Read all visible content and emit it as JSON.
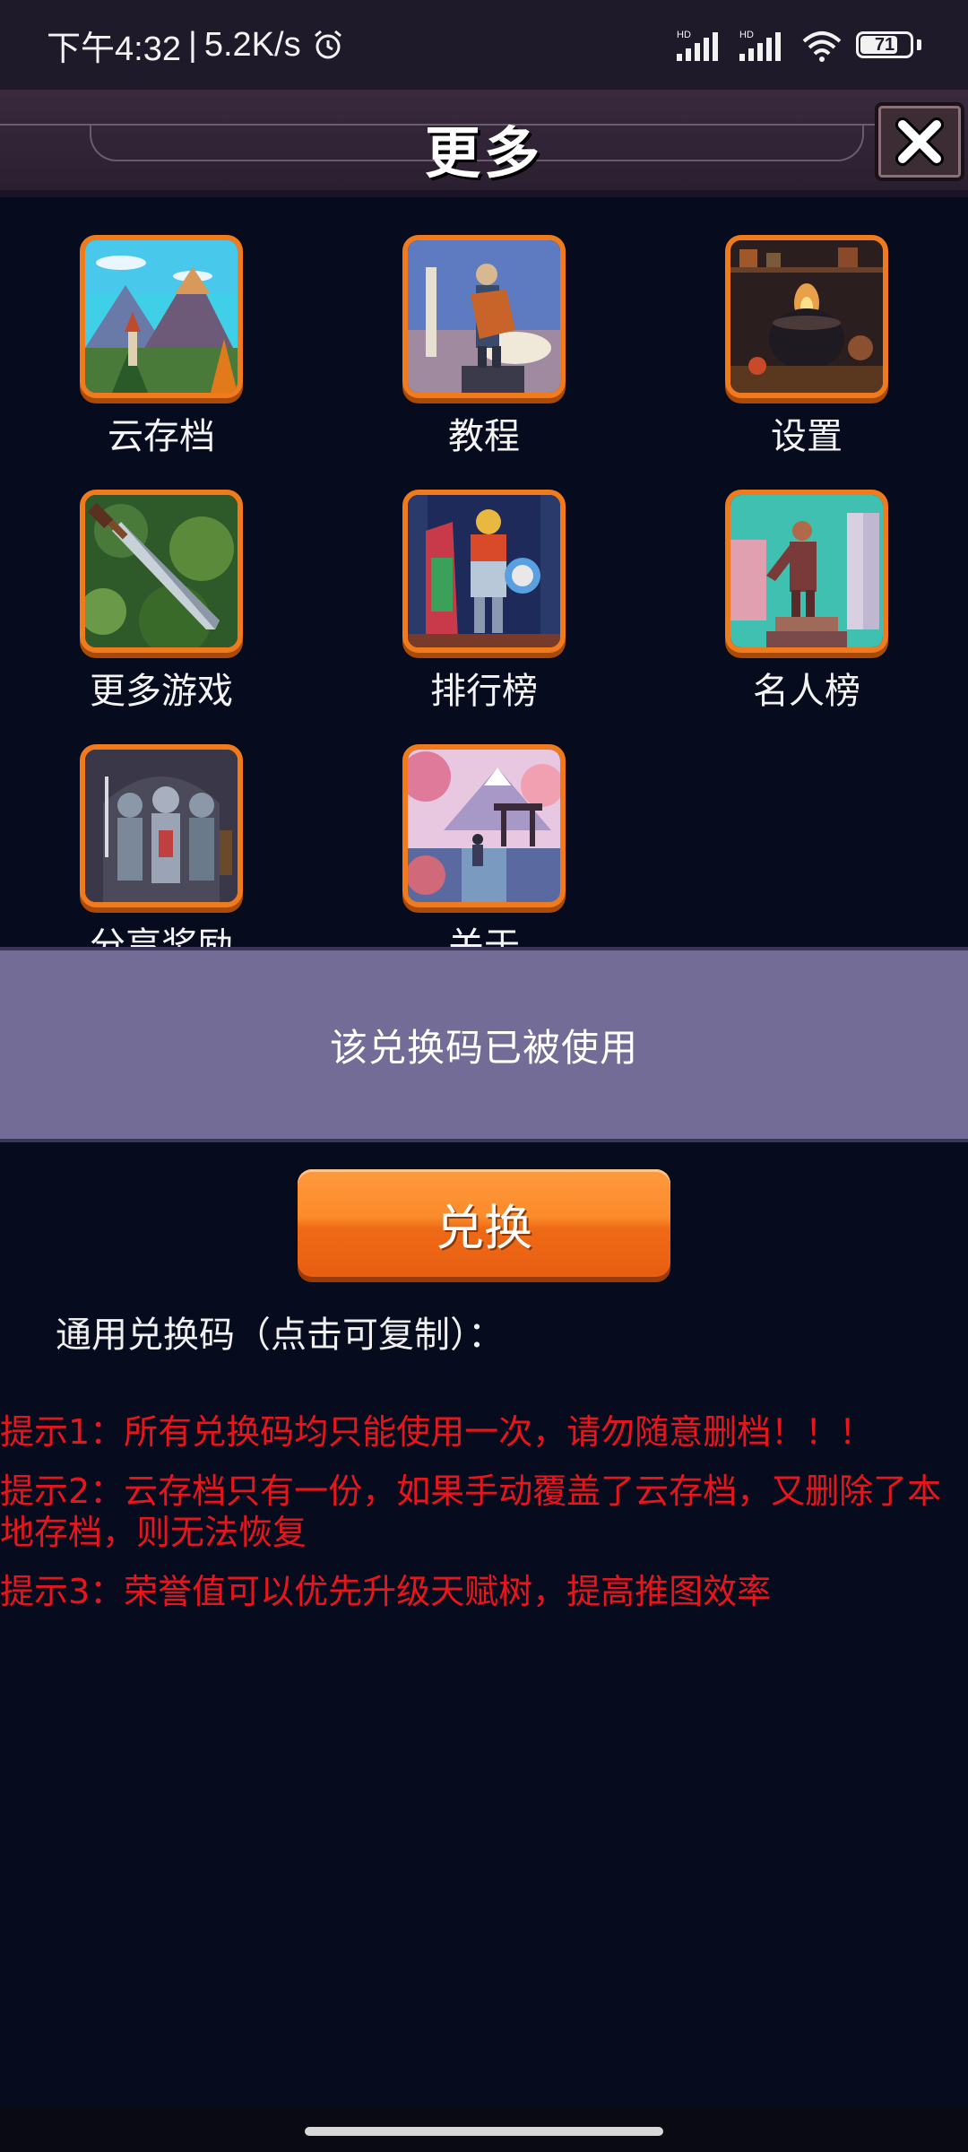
{
  "status_bar": {
    "time": "下午4:32",
    "separator": "|",
    "net_speed": "5.2K/s",
    "signal_label_1": "HD",
    "signal_label_2": "HD",
    "battery": "71"
  },
  "header": {
    "title": "更多"
  },
  "menu": {
    "items": [
      {
        "label": "云存档",
        "icon": "mountain-castle-art"
      },
      {
        "label": "教程",
        "icon": "statue-art"
      },
      {
        "label": "设置",
        "icon": "cauldron-art"
      },
      {
        "label": "更多游戏",
        "icon": "sword-art"
      },
      {
        "label": "排行榜",
        "icon": "knight-art"
      },
      {
        "label": "名人榜",
        "icon": "warrior-statue-art"
      },
      {
        "label": "分享奖励",
        "icon": "armored-knights-art"
      },
      {
        "label": "关于",
        "icon": "torii-gate-art"
      }
    ]
  },
  "notice": {
    "message": "该兑换码已被使用"
  },
  "redeem": {
    "button_label": "兑换",
    "code_heading": "通用兑换码（点击可复制）："
  },
  "tips": [
    "提示1：所有兑换码均只能使用一次，请勿随意删档！！！",
    "提示2：云存档只有一份，如果手动覆盖了云存档，又删除了本地存档，则无法恢复",
    "提示3：荣誉值可以优先升级天赋树，提高推图效率"
  ],
  "colors": {
    "accent_orange": "#f07a1c",
    "tip_red": "#e8161c",
    "notice_bg": "#726c96",
    "page_bg": "#070b1e"
  }
}
